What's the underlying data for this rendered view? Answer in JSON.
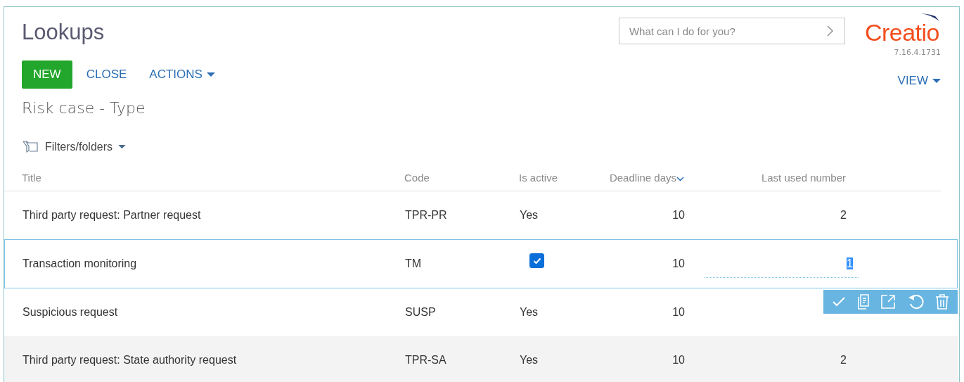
{
  "header": {
    "title": "Lookups",
    "search": {
      "placeholder": "What can I do for you?"
    },
    "logo": "Creatio",
    "version": "7.16.4.1731"
  },
  "toolbar": {
    "buttons": [
      {
        "label": "NEW",
        "kind": "primary"
      },
      {
        "label": "CLOSE",
        "kind": "link"
      },
      {
        "label": "ACTIONS",
        "kind": "menu"
      }
    ],
    "view": "VIEW"
  },
  "subtitle": "Risk case - Type",
  "filters": "Filters/folders",
  "table": {
    "columns": [
      {
        "label": "Title",
        "sorted": false
      },
      {
        "label": "Code",
        "sorted": false
      },
      {
        "label": "Is active",
        "sorted": false
      },
      {
        "label": "Deadline days",
        "sorted": true
      },
      {
        "label": "Last used number",
        "sorted": false
      }
    ],
    "rows": [
      {
        "title": "Third party request: Partner request",
        "code": "TPR-PR",
        "active": "Yes",
        "deadline": "10",
        "last_used": "2",
        "editing": false,
        "highlighted": false
      },
      {
        "title": "Transaction monitoring",
        "code": "TM",
        "active_checked": true,
        "deadline": "10",
        "last_used": "1",
        "editing": true,
        "highlighted": false
      },
      {
        "title": "Suspicious request",
        "code": "SUSP",
        "active": "Yes",
        "deadline": "10",
        "editing": false,
        "highlighted": false
      },
      {
        "title": "Third party request: State authority request",
        "code": "TPR-SA",
        "active": "Yes",
        "deadline": "10",
        "last_used": "2",
        "editing": false,
        "highlighted": true
      }
    ]
  }
}
